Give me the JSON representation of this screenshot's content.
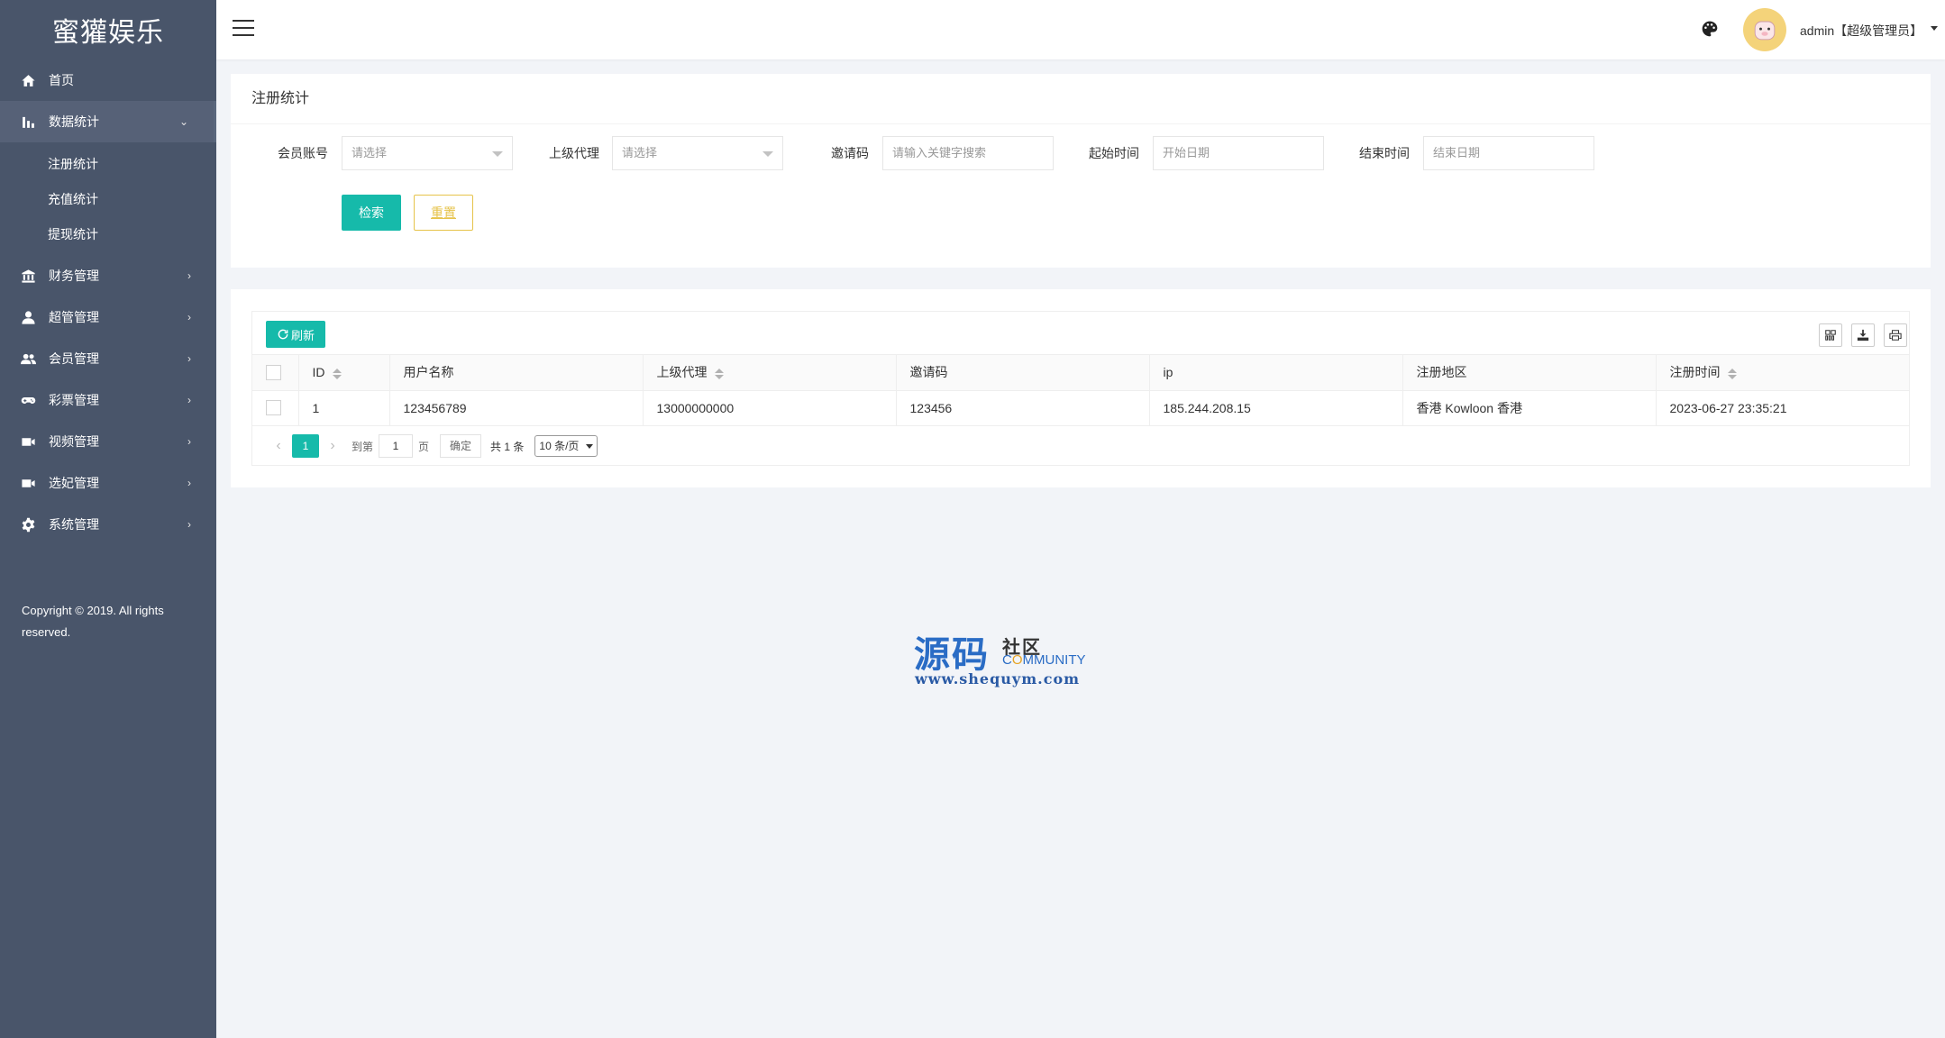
{
  "app": {
    "title": "蜜獾娱乐"
  },
  "sidebar": {
    "items": [
      {
        "label": "首页",
        "icon": "home-icon"
      },
      {
        "label": "数据统计",
        "icon": "bar-chart-icon",
        "expanded": true,
        "children": [
          "注册统计",
          "充值统计",
          "提现统计"
        ]
      },
      {
        "label": "财务管理",
        "icon": "bank-icon"
      },
      {
        "label": "超管管理",
        "icon": "user-icon"
      },
      {
        "label": "会员管理",
        "icon": "users-icon"
      },
      {
        "label": "彩票管理",
        "icon": "gamepad-icon"
      },
      {
        "label": "视频管理",
        "icon": "video-icon"
      },
      {
        "label": "选妃管理",
        "icon": "video-icon"
      },
      {
        "label": "系统管理",
        "icon": "gear-icon"
      }
    ],
    "copyright": "Copyright © 2019. All rights reserved."
  },
  "header": {
    "user": "admin【超级管理员】"
  },
  "search": {
    "title": "注册统计",
    "fields": {
      "member_label": "会员账号",
      "member_placeholder": "请选择",
      "agent_label": "上级代理",
      "agent_placeholder": "请选择",
      "invite_label": "邀请码",
      "invite_placeholder": "请输入关键字搜索",
      "start_label": "起始时间",
      "start_placeholder": "开始日期",
      "end_label": "结束时间",
      "end_placeholder": "结束日期"
    },
    "search_btn": "检索",
    "reset_btn": "重置"
  },
  "table": {
    "refresh_btn": "刷新",
    "columns": [
      "ID",
      "用户名称",
      "上级代理",
      "邀请码",
      "ip",
      "注册地区",
      "注册时间"
    ],
    "rows": [
      [
        "1",
        "123456789",
        "13000000000",
        "123456",
        "185.244.208.15",
        "香港 Kowloon 香港",
        "2023-06-27 23:35:21"
      ]
    ]
  },
  "pager": {
    "current": "1",
    "goto_label": "到第",
    "goto_value": "1",
    "page_label": "页",
    "confirm": "确定",
    "total": "共 1 条",
    "page_size": "10 条/页"
  },
  "watermark": {
    "main": "源码",
    "sub1": "社区",
    "sub2_a": "C",
    "sub2_b": "O",
    "sub2_c": "MMUNITY",
    "url": "www.shequym.com"
  }
}
